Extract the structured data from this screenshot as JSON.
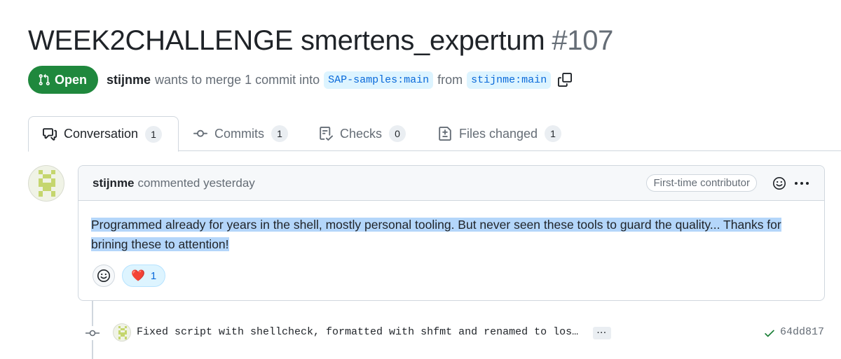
{
  "pr": {
    "title": "WEEK2CHALLENGE smertens_expertum",
    "number": "#107",
    "state": "Open",
    "author": "stijnme",
    "merge_text": "wants to merge 1 commit into",
    "base_branch": "SAP-samples:main",
    "from_text": "from",
    "head_branch": "stijnme:main"
  },
  "tabs": [
    {
      "label": "Conversation",
      "count": "1",
      "icon": "comment-discussion-icon"
    },
    {
      "label": "Commits",
      "count": "1",
      "icon": "git-commit-icon"
    },
    {
      "label": "Checks",
      "count": "0",
      "icon": "checklist-icon"
    },
    {
      "label": "Files changed",
      "count": "1",
      "icon": "file-diff-icon"
    }
  ],
  "comment": {
    "author": "stijnme",
    "meta": "commented yesterday",
    "badge": "First-time contributor",
    "body": "Programmed already for years in the shell, mostly personal tooling. But never seen these tools to guard the quality... Thanks for brining these to attention!",
    "reactions": [
      {
        "emoji": "❤️",
        "count": "1"
      }
    ]
  },
  "commit": {
    "message": "Fixed script with shellcheck, formatted with shfmt and renamed to los…",
    "ellipsis": "···",
    "sha": "64dd817",
    "status": "success"
  },
  "colors": {
    "open_green": "#1f883d",
    "link_blue": "#0969da",
    "selection": "#b4d6fa"
  }
}
